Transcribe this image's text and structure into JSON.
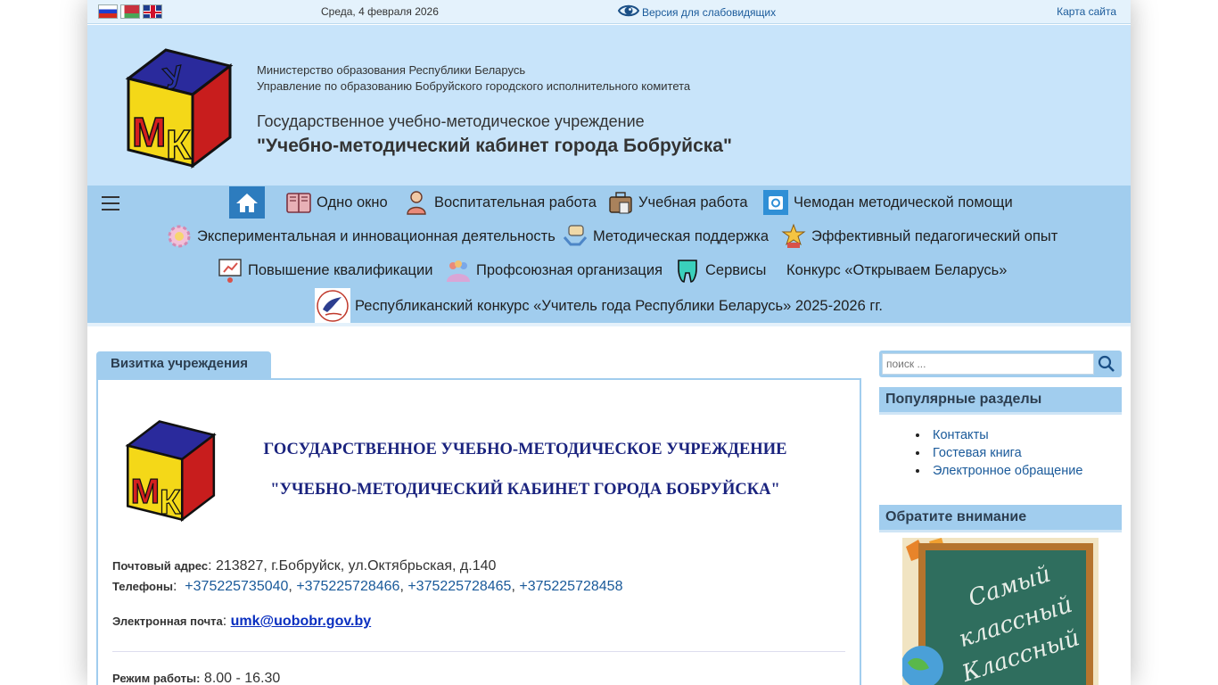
{
  "topbar": {
    "flags": [
      "flag-ru",
      "flag-by",
      "flag-en"
    ],
    "date": "Среда, 4 февраля 2026",
    "accessibility_link": "Версия для слабовидящих",
    "sitemap_link": "Карта сайта"
  },
  "header": {
    "ministry": "Министерство образования Республики Беларусь",
    "department": "Управление по образованию Бобруйского городского исполнительного комитета",
    "institution_line1": "Государственное учебно-методическое учреждение",
    "institution_line2": "\"Учебно-методический кабинет города Бобруйска\"",
    "logo_letters": "УМК"
  },
  "nav": {
    "items": [
      {
        "label": "Одно окно",
        "icon": "book-icon"
      },
      {
        "label": "Воспитательная работа",
        "icon": "teacher-icon"
      },
      {
        "label": "Учебная работа",
        "icon": "briefcase-icon"
      },
      {
        "label": "Чемодан методической помощи",
        "icon": "case-icon"
      },
      {
        "label": "Экспериментальная и инновационная деятельность",
        "icon": "gear-icon"
      },
      {
        "label": "Методическая поддержка",
        "icon": "support-icon"
      },
      {
        "label": "Эффективный педагогический опыт",
        "icon": "award-icon"
      },
      {
        "label": "Повышение квалификации",
        "icon": "growth-icon"
      },
      {
        "label": "Профсоюзная организация",
        "icon": "people-icon"
      },
      {
        "label": "Сервисы",
        "icon": "tooth-icon"
      },
      {
        "label": "Конкурс «Открываем Беларусь»",
        "icon": ""
      },
      {
        "label": "Республиканский конкурс «Учитель года Республики Беларусь» 2025-2026 гг.",
        "icon": "emblem-icon"
      }
    ]
  },
  "main": {
    "tab": "Визитка учреждения",
    "title1": "ГОСУДАРСТВЕННОЕ УЧЕБНО-МЕТОДИЧЕСКОЕ УЧРЕЖДЕНИЕ",
    "title2": "\"УЧЕБНО-МЕТОДИЧЕСКИЙ КАБИНЕТ ГОРОДА БОБРУЙСКА\"",
    "address_label": "Почтовый адрес",
    "address": ": 213827, г.Бобруйск, ул.Октябрьская, д.140",
    "phones_label": "Телефоны",
    "phones": [
      "+375225735040",
      "+375225728466",
      "+375225728465",
      "+375225728458"
    ],
    "email_label": "Электронная почта",
    "email": "umk@uobobr.gov.by",
    "hours_label": "Режим работы:",
    "hours": "8.00 - 16.30"
  },
  "sidebar": {
    "search_placeholder": "поиск ...",
    "popular_title": "Популярные разделы",
    "popular_links": [
      "Контакты",
      "Гостевая книга",
      "Электронное обращение"
    ],
    "attention_title": "Обратите внимание",
    "banner_text": [
      "Самый",
      "классный",
      "Классный"
    ]
  }
}
